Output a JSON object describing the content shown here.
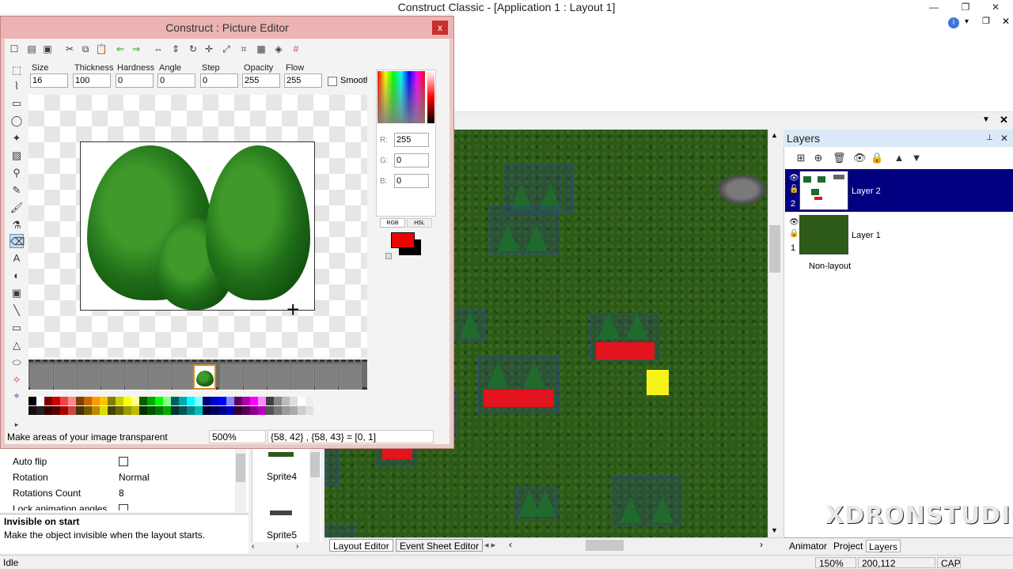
{
  "main_window": {
    "title": "Construct Classic - [Application 1 : Layout 1]"
  },
  "picture_editor": {
    "title": "Construct : Picture Editor",
    "close_label": "x",
    "fields": [
      {
        "label": "Size",
        "value": "16"
      },
      {
        "label": "Thickness",
        "value": "100"
      },
      {
        "label": "Hardness",
        "value": "0"
      },
      {
        "label": "Angle",
        "value": "0"
      },
      {
        "label": "Step",
        "value": "0"
      },
      {
        "label": "Opacity",
        "value": "255"
      },
      {
        "label": "Flow",
        "value": "255"
      }
    ],
    "smooth_label": "Smooth",
    "color": {
      "r_label": "R:",
      "r": "255",
      "g_label": "G:",
      "g": "0",
      "b_label": "B:",
      "b": "0",
      "tab_rgb": "RGB",
      "tab_hsl": "HSL",
      "primary": "#f20000",
      "secondary": "#000000"
    },
    "status": {
      "message": "Make areas of your image transparent",
      "zoom": "500%",
      "coords": "{58, 42} , {58, 43} = [0, 1]"
    }
  },
  "properties": [
    {
      "label": "Auto flip",
      "value": "",
      "checkbox": true
    },
    {
      "label": "Rotation",
      "value": "Normal"
    },
    {
      "label": "Rotations Count",
      "value": "8"
    },
    {
      "label": "Lock animation angles",
      "value": "",
      "checkbox": true
    }
  ],
  "help": {
    "title": "Invisible on start",
    "text": "Make the object invisible when the layout starts."
  },
  "object_list": [
    {
      "label": "Sprite4"
    },
    {
      "label": "Sprite5"
    }
  ],
  "layout_tabs": [
    {
      "label": "Layout Editor"
    },
    {
      "label": "Event Sheet Editor"
    }
  ],
  "layers": {
    "title": "Layers",
    "items": [
      {
        "name": "Layer 2",
        "number": "2"
      },
      {
        "name": "Layer 1",
        "number": "1"
      },
      {
        "name": "Non-layout"
      }
    ]
  },
  "bottom_tabs": [
    {
      "label": "Animator"
    },
    {
      "label": "Project"
    },
    {
      "label": "Layers"
    }
  ],
  "statusbar": {
    "state": "Idle",
    "zoom": "150%",
    "coords": "200,112",
    "caps": "CAP"
  },
  "watermark": "XDRONSTUDIO"
}
